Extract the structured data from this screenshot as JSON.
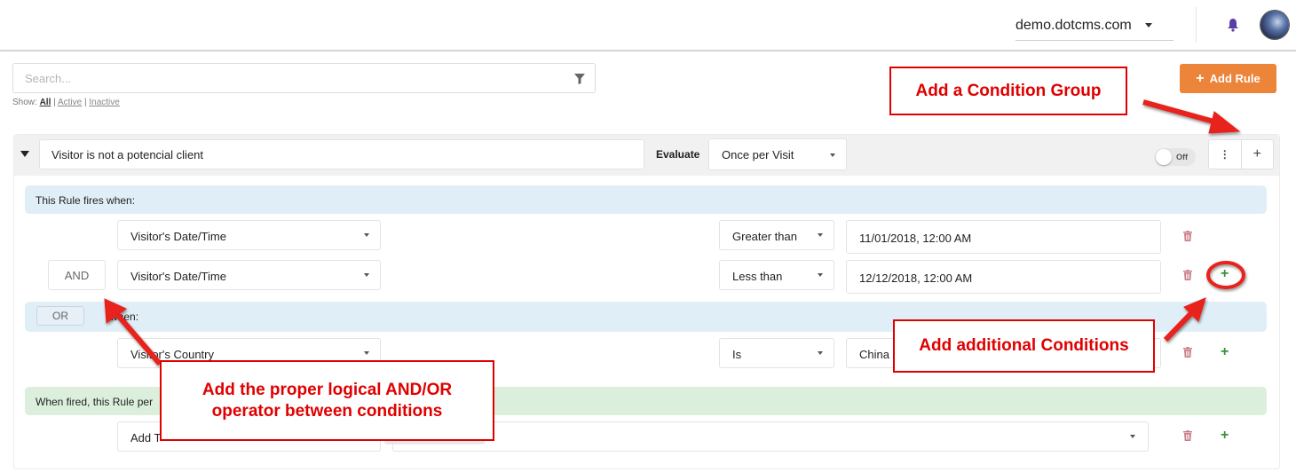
{
  "topbar": {
    "site": "demo.dotcms.com",
    "icons": {
      "bell": "bell-icon",
      "avatar": "user-avatar"
    }
  },
  "search": {
    "placeholder": "Search...",
    "filter_icon": "filter-icon"
  },
  "show_filter": {
    "label": "Show:",
    "options": [
      "All",
      "Active",
      "Inactive"
    ],
    "selected": "All"
  },
  "add_rule": {
    "label": "Add Rule",
    "icon": "plus-icon"
  },
  "rule": {
    "name": "Visitor is not a potencial client",
    "evaluate_label": "Evaluate",
    "evaluate_value": "Once per Visit",
    "toggle_label": "Off",
    "toggle_on": false,
    "menu_icon": "vertical-dots-icon",
    "add_group_icon": "plus-icon",
    "conditions_header": "This Rule fires when:",
    "group1": [
      {
        "operator": "",
        "type": "Visitor's Date/Time",
        "comparison": "Greater than",
        "value": "11/01/2018, 12:00 AM"
      },
      {
        "operator": "AND",
        "type": "Visitor's Date/Time",
        "comparison": "Less than",
        "value": "12/12/2018, 12:00 AM"
      }
    ],
    "group2_operator": "OR",
    "group2_header": "when:",
    "group2": [
      {
        "type": "Visitor's Country",
        "comparison": "Is",
        "value": "China"
      }
    ],
    "actions_header": "When fired, this Rule per",
    "action": {
      "type": "Add T"
    }
  },
  "annotations": {
    "condition_group": "Add a Condition Group",
    "additional_conditions": "Add additional Conditions",
    "logical_operator_line1": "Add the proper logical AND/OR",
    "logical_operator_line2": "operator between conditions",
    "color": "#e00000"
  },
  "colors": {
    "accent_orange": "#ec843a",
    "conditions_band": "#e0eff7",
    "actions_band": "#dcefdc",
    "delete_red": "#c97c85",
    "add_green": "#3e8e3e"
  }
}
